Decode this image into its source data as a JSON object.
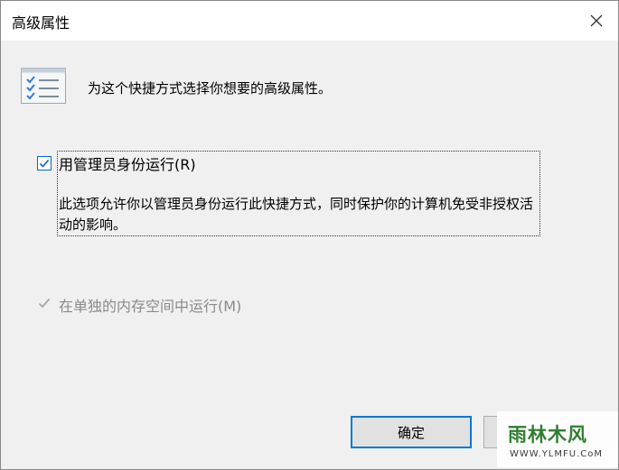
{
  "dialog": {
    "title": "高级属性",
    "close_label": "×",
    "intro": "为这个快捷方式选择你想要的高级属性。",
    "options": [
      {
        "label": "用管理员身份运行(R)",
        "checked": true,
        "description": "此选项允许你以管理员身份运行此快捷方式，同时保护你的计算机免受非授权活动的影响。",
        "enabled": true
      },
      {
        "label": "在单独的内存空间中运行(M)",
        "checked": true,
        "enabled": false
      }
    ],
    "ok_label": "确定",
    "cancel_label": ""
  },
  "watermark": {
    "main": "雨林木风",
    "sub": "WWW.YLMFU.CoM"
  },
  "colors": {
    "accent": "#0078d7",
    "check": "#0a64c8",
    "disabled": "#8a8a8a"
  },
  "icons": {
    "close": "close-icon",
    "header": "checklist-icon",
    "check": "checkmark-icon"
  }
}
